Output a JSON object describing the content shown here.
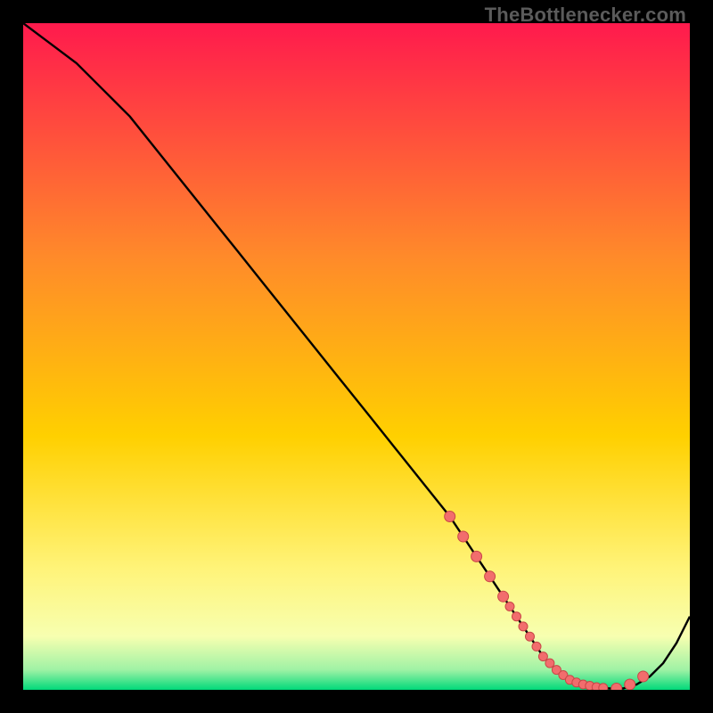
{
  "watermark": "TheBottleneсker.com",
  "colors": {
    "gradient_top": "#ff1a4d",
    "gradient_mid1": "#ff6a2a",
    "gradient_mid2": "#ffd000",
    "gradient_mid3": "#fff47a",
    "gradient_bottom": "#00d97a",
    "curve": "#000000",
    "marker_fill": "#f26d6d",
    "marker_stroke": "#c94747"
  },
  "chart_data": {
    "type": "line",
    "title": "",
    "xlabel": "",
    "ylabel": "",
    "xlim": [
      0,
      100
    ],
    "ylim": [
      0,
      100
    ],
    "grid": false,
    "legend": false,
    "series": [
      {
        "name": "bottleneck-curve",
        "x": [
          0,
          4,
          8,
          12,
          16,
          20,
          24,
          28,
          32,
          36,
          40,
          44,
          48,
          52,
          56,
          60,
          64,
          66,
          68,
          70,
          72,
          74,
          76,
          78,
          80,
          82,
          84,
          86,
          88,
          90,
          92,
          94,
          96,
          98,
          100
        ],
        "y": [
          100,
          97,
          94,
          90,
          86,
          81,
          76,
          71,
          66,
          61,
          56,
          51,
          46,
          41,
          36,
          31,
          26,
          23,
          20,
          17,
          14,
          11,
          8,
          5,
          3,
          1.5,
          0.8,
          0.4,
          0.2,
          0.2,
          0.8,
          2,
          4,
          7,
          11
        ]
      }
    ],
    "markers": {
      "name": "highlighted-points",
      "x": [
        64,
        66,
        68,
        70,
        72,
        73,
        74,
        75,
        76,
        77,
        78,
        79,
        80,
        81,
        82,
        83,
        84,
        85,
        86,
        87,
        89,
        91,
        93
      ],
      "y": [
        26,
        23,
        20,
        17,
        14,
        12.5,
        11,
        9.5,
        8,
        6.5,
        5,
        4,
        3,
        2.2,
        1.5,
        1.1,
        0.8,
        0.6,
        0.4,
        0.3,
        0.2,
        0.8,
        2
      ],
      "r": [
        6,
        6,
        6,
        6,
        6,
        5,
        5,
        5,
        5,
        5,
        5,
        5,
        5,
        5,
        5,
        5,
        5,
        5,
        5,
        5,
        6,
        6,
        6
      ]
    }
  }
}
